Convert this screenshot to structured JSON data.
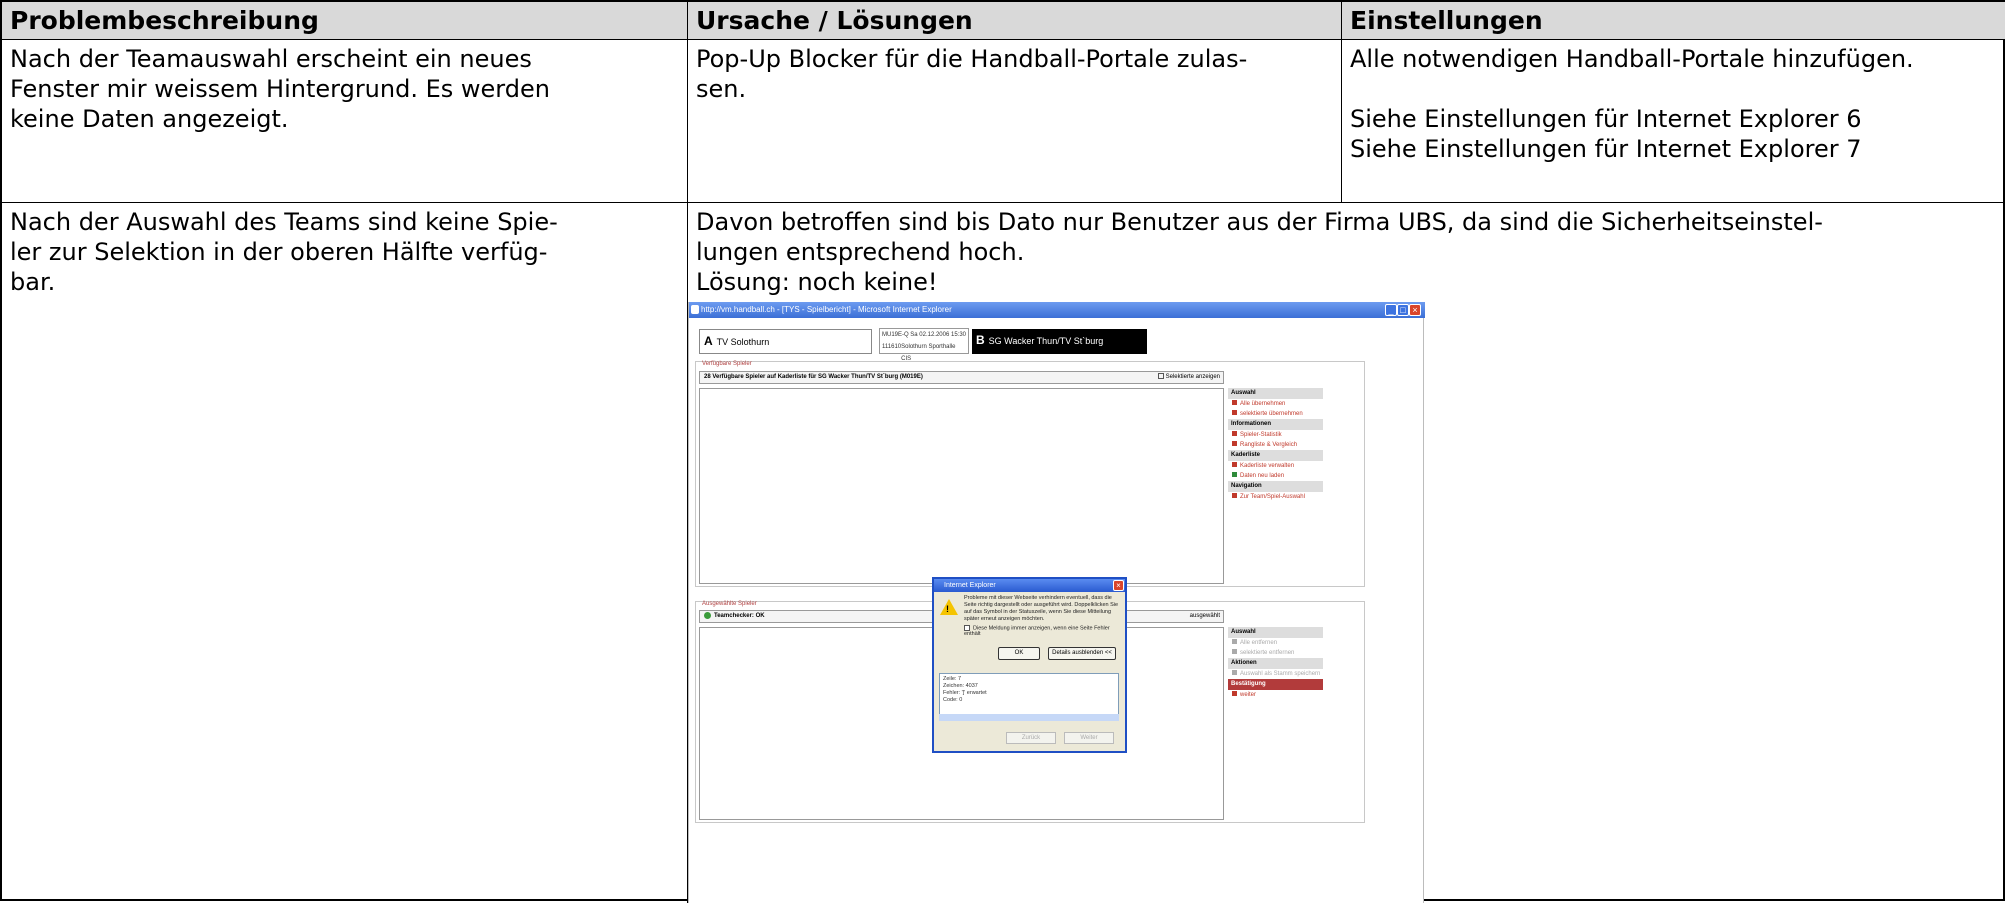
{
  "table": {
    "headers": {
      "problem": "Problembeschreibung",
      "cause": "Ursache / Lösungen",
      "settings": "Einstellungen"
    },
    "row1": {
      "problem_lines": [
        "Nach der Teamauswahl erscheint ein neues",
        "Fenster mir weissem Hintergrund. Es werden",
        "keine Daten angezeigt."
      ],
      "cause_lines": [
        "Pop-Up Blocker für die Handball-Portale zulas-",
        "sen."
      ],
      "settings_line1": "Alle notwendigen Handball-Portale hinzufügen.",
      "settings_line2": "Siehe Einstellungen für Internet Explorer 6",
      "settings_line3": "Siehe Einstellungen für Internet Explorer 7"
    },
    "row2": {
      "problem_lines": [
        "Nach der Auswahl des Teams sind keine Spie-",
        "ler zur Selektion in der oberen Hälfte verfüg-",
        "bar."
      ],
      "cause_lines": [
        "Davon betroffen sind bis Dato nur Benutzer aus der Firma UBS, da sind die Sicherheitseinstel-",
        "lungen entsprechend hoch."
      ],
      "solution": "Lösung: noch keine!"
    }
  },
  "screenshot": {
    "window_title": "http://vm.handball.ch - [TYS - Spielbericht] - Microsoft Internet Explorer",
    "team_a_letter": "A",
    "team_a_name": "TV Solothurn",
    "match_code": "MU19E-Q",
    "match_date": "Sa 02.12.2006 15:30",
    "match_number": "111610",
    "match_venue": "Solothurn Sporthalle CIS",
    "team_b_letter": "B",
    "team_b_name": "SG Wacker Thun/TV St`burg",
    "available_title": "Verfügbare Spieler",
    "available_bar": "28 Verfügbare Spieler auf Kaderliste für SG Wacker Thun/TV St`burg (M019E)",
    "show_selected": "Selektierte anzeigen",
    "side_top": [
      {
        "header": "Auswahl",
        "items": [
          "Alle übernehmen",
          "selektierte übernehmen"
        ]
      },
      {
        "header": "Informationen",
        "items": [
          "Spieler-Statistik",
          "Rangliste & Vergleich"
        ]
      },
      {
        "header": "Kaderliste",
        "items": [
          "Kaderliste verwalten",
          "Daten neu laden"
        ]
      },
      {
        "header": "Navigation",
        "items": [
          "Zur Team/Spiel-Auswahl"
        ]
      }
    ],
    "selected_title": "Ausgewählte Spieler",
    "teamcheck": "Teamchecker: OK",
    "selected_bar_right": "ausgewählt",
    "side_bottom": [
      {
        "header": "Auswahl",
        "items": [
          "Alle entfernen",
          "selektierte entfernen"
        ]
      },
      {
        "header": "Aktionen",
        "items": [
          "Auswahl als Stamm speichern"
        ]
      },
      {
        "header": "Bestätigung",
        "items": [
          "weiter"
        ]
      }
    ],
    "dialog": {
      "title": "Internet Explorer",
      "message": "Probleme mit dieser Webseite verhindern eventuell, dass die Seite richtig dargestellt oder ausgeführt wird. Doppelklicken Sie auf das Symbol in der Statuszeile, wenn Sie diese Mitteilung später erneut anzeigen möchten.",
      "checkbox": "Diese Meldung immer anzeigen, wenn eine Seite Fehler enthält",
      "ok": "OK",
      "details": "Details ausblenden <<",
      "detail_lines": [
        "Zeile: 7",
        "Zeichen: 4037",
        "Fehler: ']' erwartet",
        "Code: 0"
      ],
      "back": "Zurück",
      "next": "Weiter"
    }
  }
}
